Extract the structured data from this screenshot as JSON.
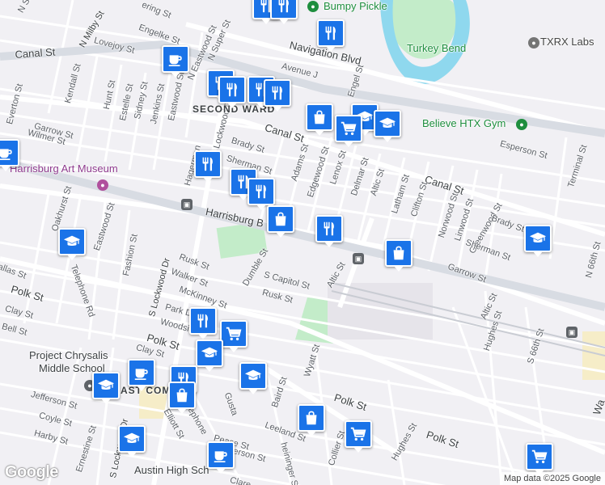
{
  "map": {
    "google_logo": "Google",
    "attribution": "Map data ©2025 Google",
    "pois": {
      "bumpy_pickle": "Bumpy Pickle",
      "turkey_bend": "Turkey Bend",
      "txrx_labs": "TXRX Labs",
      "believe_gym": "Believe HTX Gym",
      "harrisburg_art_museum": "Harrisburg Art Museum",
      "project_chrysalis_line1": "Project Chrysalis",
      "project_chrysalis_line2": "Middle School",
      "austin_high": "Austin High Sch"
    },
    "neighborhoods": {
      "second_ward": "SECOND WARD",
      "east_end_partial": "EAST COM"
    },
    "streets": {
      "n_sa": "N Sa",
      "ring_st": "ering St",
      "n_milby_st": "N Milby St",
      "lovejoy_st": "Lovejoy St",
      "engelke_st": "Engelke St",
      "n_eastwood": "N Eastwood St",
      "super_st": "N Super St",
      "navigation_blvd": "Navigation Blvd",
      "canal_st_west": "Canal St",
      "canal_st_mid": "Canal St",
      "canal_st_east": "Canal St",
      "avenue_j": "Avenue J",
      "engel_st": "Engel St",
      "kendall_st": "Kendall St",
      "hunt_st": "Hunt St",
      "estelle_st": "Estelle St",
      "sidney_st": "Sidney St",
      "jenkins_st": "Jenkins St",
      "eastwood_st": "Eastwood St",
      "everton_st": "Everton St",
      "garrow_st_west": "Garrow St",
      "wilmer_st": "Wilmer St",
      "brady_st_west": "Brady St",
      "sherman_st_west": "Sherman St",
      "hagerman": "Hagerman",
      "lockwood_dr_n": "Lockwood Dr",
      "adams_st": "Adams St",
      "edgewood_st": "Edgewood St",
      "lenox_st": "Lenox St",
      "delmar_st": "Delmar St",
      "altic_st": "Altic St",
      "latham_st": "Latham St",
      "clifton_st": "Clifton St",
      "norwood_st": "Norwood St",
      "linwood_st": "Linwood St",
      "greenwood_st": "Greenwood St",
      "esperson_st": "Esperson St",
      "terminal_st": "Terminal St",
      "harrisburg_blvd": "Harrisburg B",
      "brady_st_east": "Brady St",
      "sherman_st_east": "Sherman St",
      "garrow_st_east": "Garrow St",
      "n_66th_st": "N 66th St",
      "oakhurst_st": "Oakhurst St",
      "eastwood_st_south": "Eastwood St",
      "fashion_st": "Fashion St",
      "telephone_rd": "Telephone Rd",
      "dallas_st": "allas St",
      "rusk_st": "Rusk St",
      "walker_st": "Walker St",
      "mckinney_st": "McKinney St",
      "dumble_st": "Dumble St",
      "s_capitol_st": "S Capitol St",
      "altic_st_south": "Altic St",
      "rusk_st_south": "Rusk St",
      "polk_st_west": "Polk St",
      "clay_st": "Clay St",
      "bell_st": "Bell St",
      "s_lockwood_dr": "S Lockwood Dr",
      "woodside": "Woodside",
      "park_dr": "Park Dr",
      "polk_st_mid": "Polk St",
      "polk_st_east": "Polk St",
      "polk_st_far": "Polk St",
      "clay_st_mid": "Clay St",
      "wyatt_st": "Wyatt St",
      "baird_st": "Baird St",
      "gusta": "Gusta",
      "leeland_st": "Leeland St",
      "jefferson_st": "Jefferson St",
      "coyle_st": "Coyle St",
      "harby_st": "Harby St",
      "ernestine_st": "Ernestine St",
      "s_lockwood_dr_2": "S Lockwood Dr",
      "elliott_st": "Elliott St",
      "telephone_2": "ephone",
      "pease_st": "Pease St",
      "jefferson_st_2": "erson St",
      "clare": "Clare",
      "s_66th_st": "S 66th St",
      "hughes_st": "Hughes St",
      "hughes_st_2": "Hughes St",
      "collier_st": "Collier St",
      "heininger_st": "heininger St",
      "way": "Wa",
      "altic_st_3": "Altic St"
    },
    "pins": [
      {
        "icon": "restaurant-icon"
      },
      {
        "icon": "restaurant-icon"
      },
      {
        "icon": "restaurant-icon"
      },
      {
        "icon": "cafe-icon"
      },
      {
        "icon": "restaurant-icon"
      },
      {
        "icon": "restaurant-icon"
      },
      {
        "icon": "restaurant-icon"
      },
      {
        "icon": "restaurant-icon"
      },
      {
        "icon": "shopping-bag-icon"
      },
      {
        "icon": "school-icon"
      },
      {
        "icon": "shopping-cart-icon"
      },
      {
        "icon": "school-icon"
      },
      {
        "icon": "cafe-icon"
      },
      {
        "icon": "restaurant-icon"
      },
      {
        "icon": "restaurant-icon"
      },
      {
        "icon": "restaurant-icon"
      },
      {
        "icon": "shopping-bag-icon"
      },
      {
        "icon": "restaurant-icon"
      },
      {
        "icon": "school-icon"
      },
      {
        "icon": "school-icon"
      },
      {
        "icon": "shopping-bag-icon"
      },
      {
        "icon": "restaurant-icon"
      },
      {
        "icon": "shopping-cart-icon"
      },
      {
        "icon": "school-icon"
      },
      {
        "icon": "cafe-icon"
      },
      {
        "icon": "school-icon"
      },
      {
        "icon": "restaurant-icon"
      },
      {
        "icon": "shopping-bag-icon"
      },
      {
        "icon": "school-icon"
      },
      {
        "icon": "shopping-bag-icon"
      },
      {
        "icon": "shopping-cart-icon"
      },
      {
        "icon": "school-icon"
      },
      {
        "icon": "cafe-icon"
      },
      {
        "icon": "shopping-cart-icon"
      }
    ],
    "colors": {
      "background": "#f1f0f4",
      "road": "#ffffff",
      "highway": "#d8dce3",
      "water": "#8fd8ee",
      "park": "#c3ecc9",
      "pin": "#1a73e8",
      "poi_green": "#1e8e3e",
      "museum_purple": "#b0509d"
    }
  }
}
